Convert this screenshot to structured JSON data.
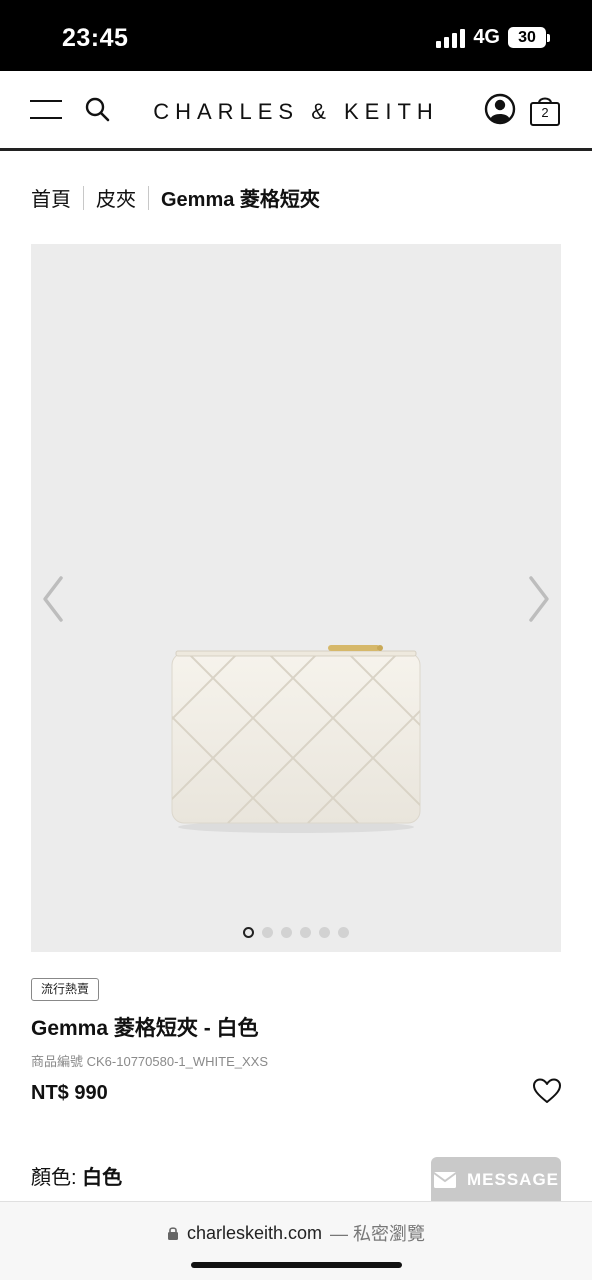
{
  "status_bar": {
    "time": "23:45",
    "network": "4G",
    "battery": "30"
  },
  "header": {
    "brand": "CHARLES & KEITH",
    "bag_count": "2",
    "icons": [
      "menu-icon",
      "search-icon",
      "account-icon",
      "shopping-bag-icon"
    ]
  },
  "breadcrumb": {
    "items": [
      "首頁",
      "皮夾",
      "Gemma 菱格短夾"
    ]
  },
  "gallery": {
    "image_count": 6,
    "active_index": 0,
    "icons": [
      "chevron-left-icon",
      "chevron-right-icon"
    ]
  },
  "product": {
    "badge": "流行熱賣",
    "title": "Gemma 菱格短夾 - 白色",
    "sku": "商品編號 CK6-10770580-1_WHITE_XXS",
    "price": "NT$ 990",
    "color_label": "顏色:",
    "color_value": "白色"
  },
  "chat": {
    "label": "MESSAGE"
  },
  "browser": {
    "url": "charleskeith.com",
    "mode": "— 私密瀏覽"
  },
  "colors": {
    "gallery_bg": "#ececec",
    "product_white": "#f2efe8",
    "zip_gold": "#d6b86a",
    "message_bg": "#c9c9c9"
  }
}
